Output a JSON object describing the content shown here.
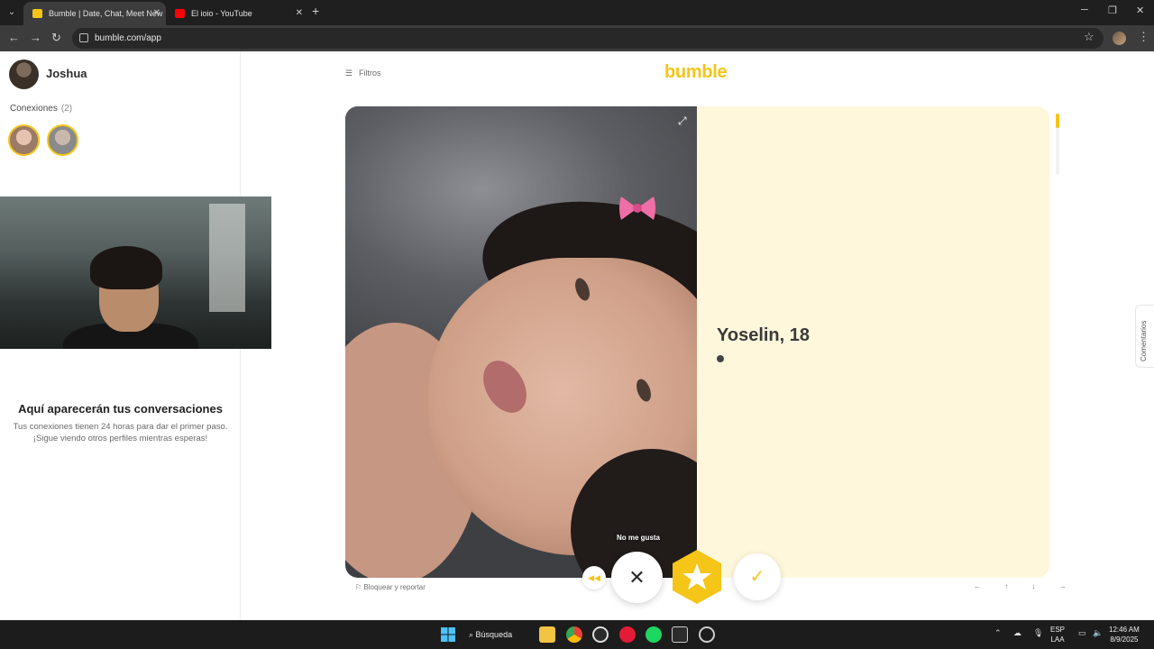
{
  "browser": {
    "tabs": [
      {
        "title": "Bumble | Date, Chat, Meet New",
        "favicon_color": "#f5c518",
        "active": true
      },
      {
        "title": "El ioio - YouTube",
        "favicon_color": "#ff0000",
        "active": false
      }
    ],
    "new_tab_icon": "+",
    "url": "bumble.com/app"
  },
  "sidebar": {
    "user_name": "Joshua",
    "connections_label": "Conexiones",
    "connections_count": "(2)",
    "empty_title": "Aquí aparecerán tus conversaciones",
    "empty_subtitle_1": "Tus conexiones tienen 24 horas para dar el primer paso.",
    "empty_subtitle_2": "¡Sigue viendo otros perfiles mientras esperas!"
  },
  "main": {
    "filters_label": "Filtros",
    "logo": "bumble",
    "profile": {
      "name_age": "Yoselin, 18"
    },
    "feedback_tab": "Comentarios",
    "tooltip": "No me gusta",
    "report_label": "Bloquear y reportar",
    "keyboard_hints": "← ↑ ↓ →"
  },
  "taskbar": {
    "search_label": "Búsqueda",
    "lang_top": "ESP",
    "lang_bottom": "LAA",
    "time": "12:46 AM",
    "date": "8/9/2025"
  },
  "colors": {
    "accent": "#f5c518",
    "card_bg": "#fff7dc"
  }
}
